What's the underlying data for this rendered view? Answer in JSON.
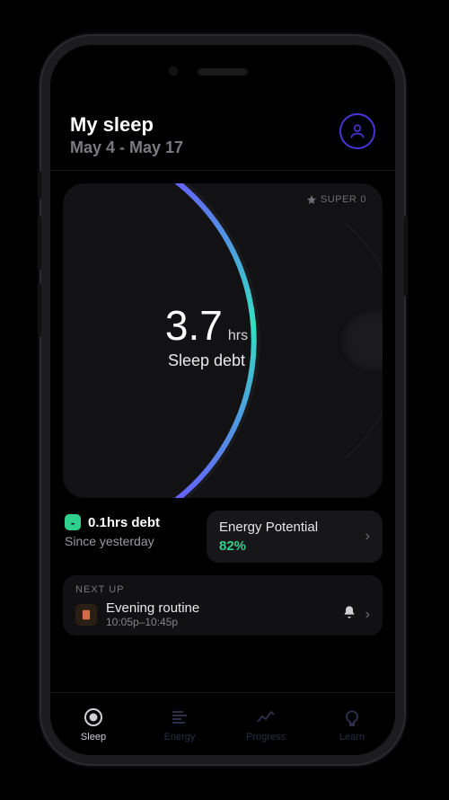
{
  "header": {
    "title": "My sleep",
    "date_range": "May 4 - May 17"
  },
  "super_badge": {
    "label": "SUPER",
    "count": "0"
  },
  "score": {
    "value": "3.7",
    "unit": "hrs",
    "label": "Sleep debt"
  },
  "delta": {
    "chip": "-",
    "main": "0.1hrs debt",
    "sub": "Since yesterday"
  },
  "energy": {
    "label": "Energy Potential",
    "value": "82%"
  },
  "nextup": {
    "section": "NEXT UP",
    "title": "Evening routine",
    "time": "10:05p–10:45p"
  },
  "tabs": [
    {
      "label": "Sleep"
    },
    {
      "label": "Energy"
    },
    {
      "label": "Progress"
    },
    {
      "label": "Learn"
    }
  ],
  "colors": {
    "accent": "#4a33d6",
    "good": "#2fcf8e"
  }
}
